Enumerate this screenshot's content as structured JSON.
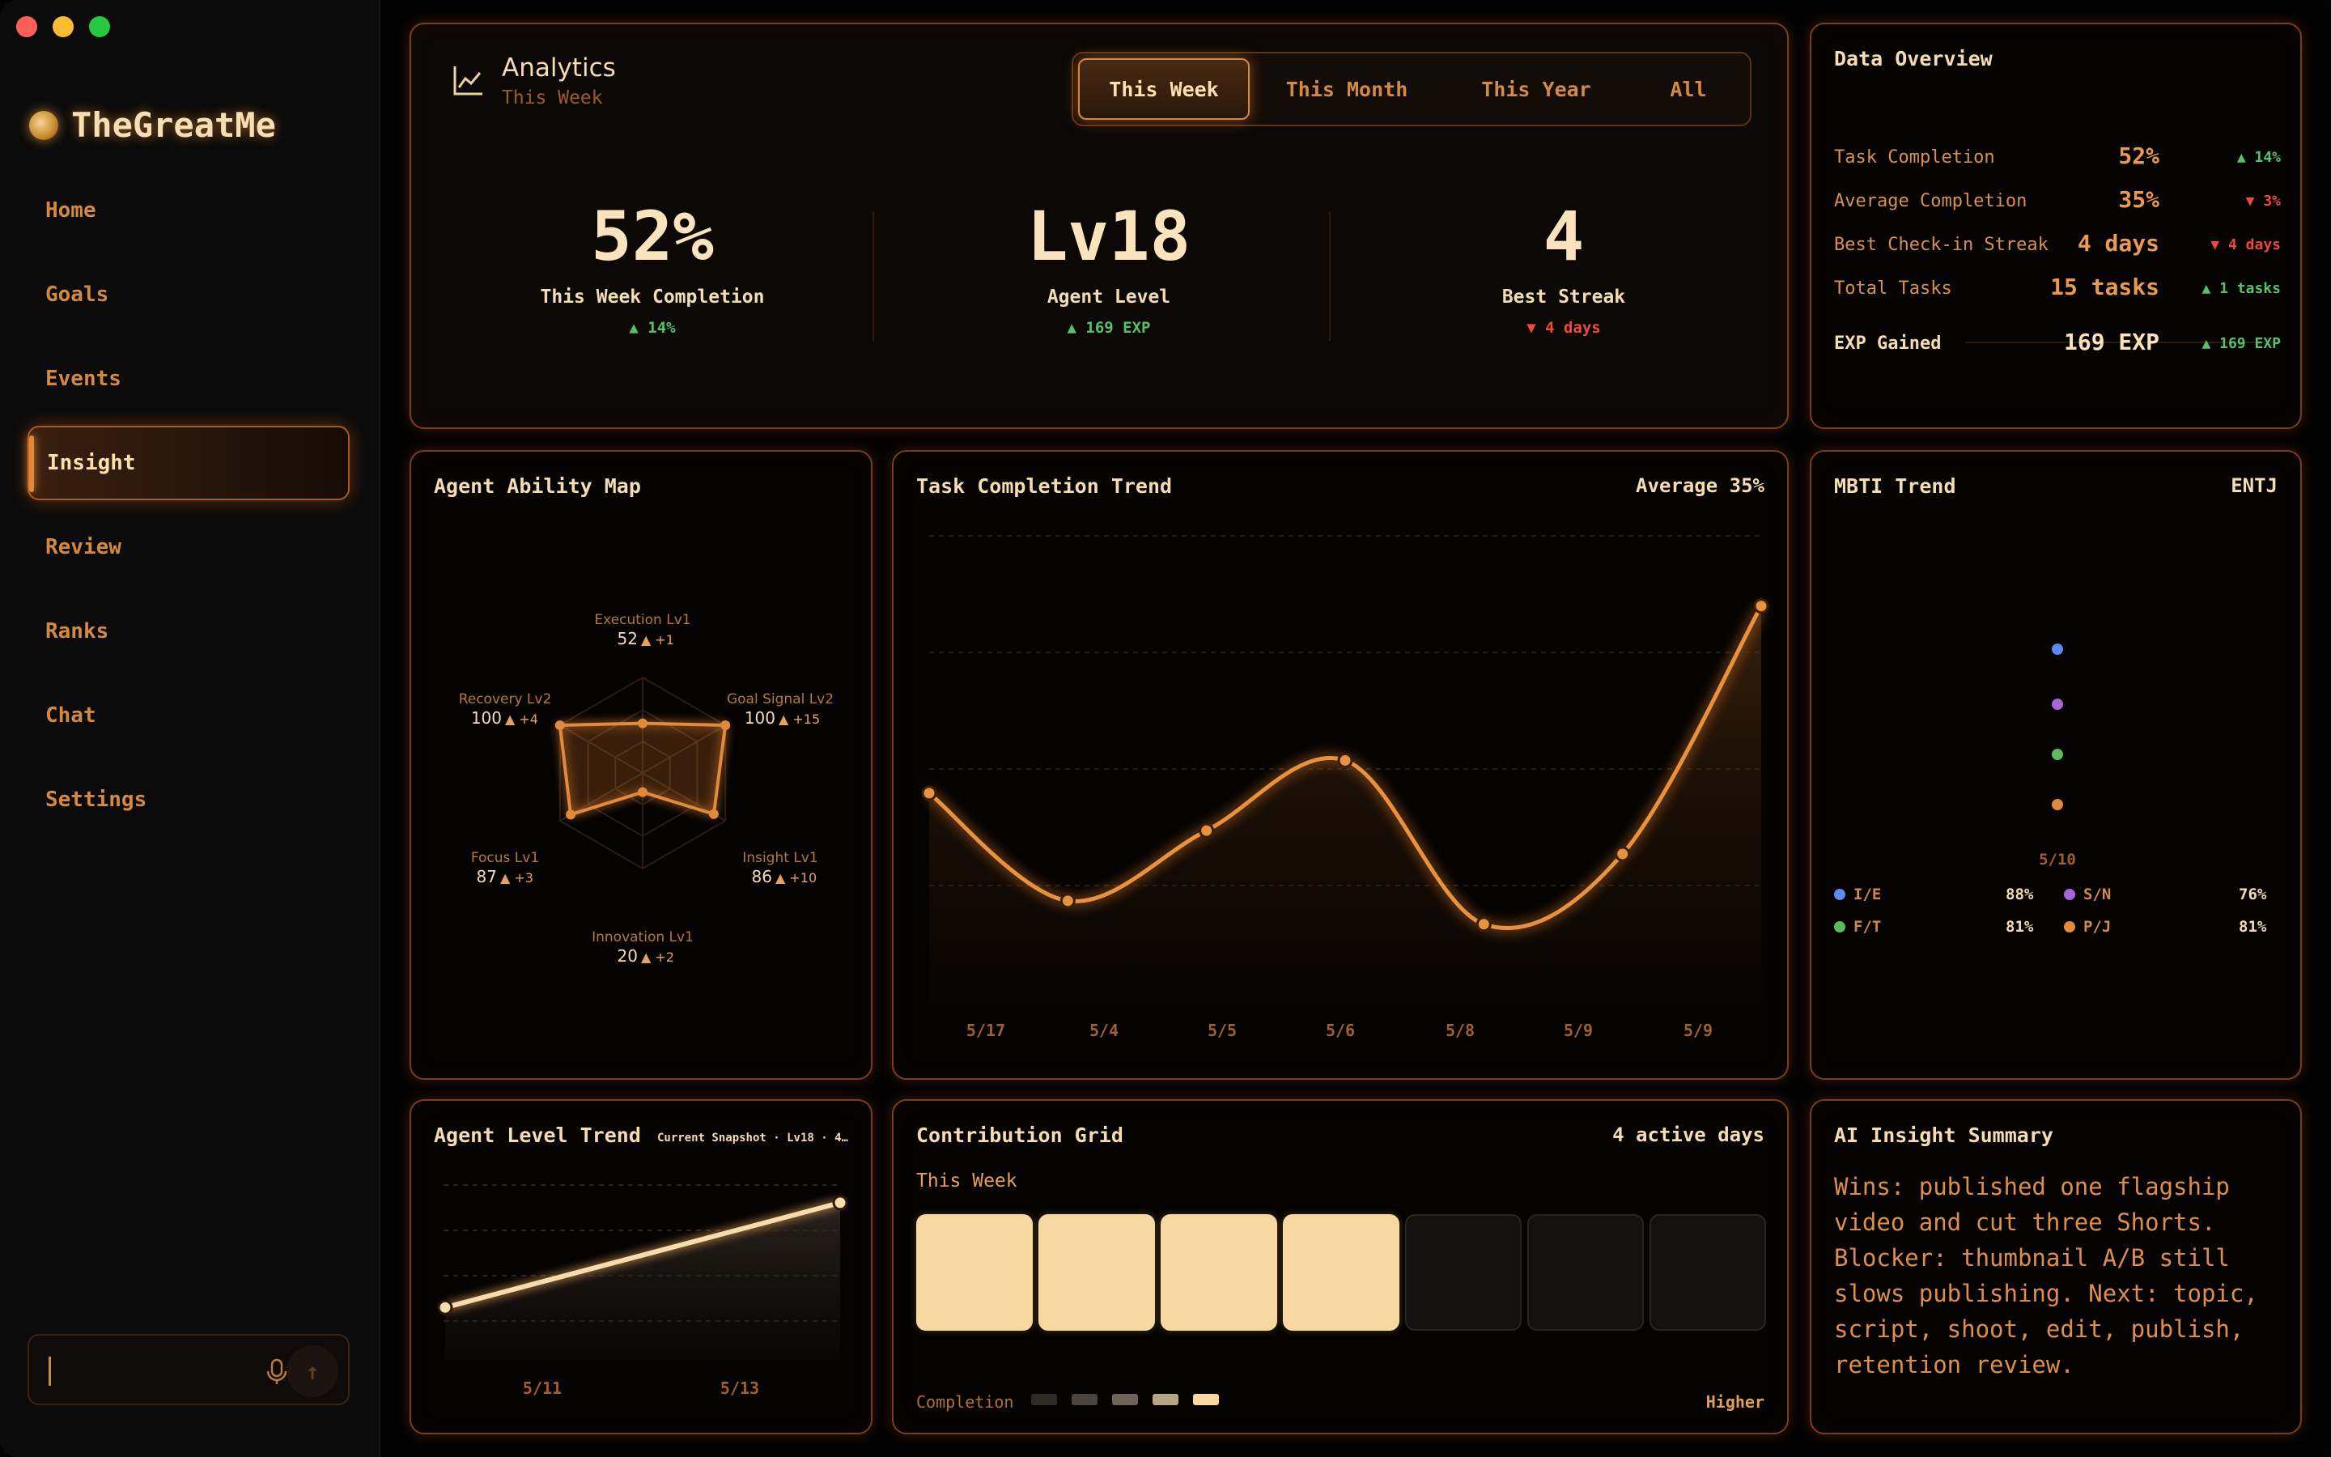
{
  "brand": {
    "name": "TheGreatMe"
  },
  "nav": {
    "items": [
      {
        "label": "Home"
      },
      {
        "label": "Goals"
      },
      {
        "label": "Events"
      },
      {
        "label": "Insight"
      },
      {
        "label": "Review"
      },
      {
        "label": "Ranks"
      },
      {
        "label": "Chat"
      },
      {
        "label": "Settings"
      }
    ],
    "active": "Insight"
  },
  "chat": {
    "value": "",
    "placeholder": ""
  },
  "analytics": {
    "title": "Analytics",
    "subtitle": "This Week",
    "tabs": [
      {
        "label": "This Week"
      },
      {
        "label": "This Month"
      },
      {
        "label": "This Year"
      },
      {
        "label": "All"
      }
    ],
    "active_tab": "This Week",
    "stats": [
      {
        "value": "52%",
        "label": "This Week Completion",
        "change": "▲ 14%",
        "trend": "up"
      },
      {
        "value": "Lv18",
        "label": "Agent Level",
        "change": "▲ 169 EXP",
        "trend": "up"
      },
      {
        "value": "4",
        "label": "Best Streak",
        "change": "▼ 4 days",
        "trend": "down"
      }
    ]
  },
  "overview": {
    "title": "Data Overview",
    "rows": [
      {
        "label": "Task Completion",
        "value": "52%",
        "change": "▲ 14%",
        "trend": "up"
      },
      {
        "label": "Average Completion",
        "value": "35%",
        "change": "▼ 3%",
        "trend": "down"
      },
      {
        "label": "Best Check-in Streak",
        "value": "4 days",
        "change": "▼ 4 days",
        "trend": "down"
      },
      {
        "label": "Total Tasks",
        "value": "15 tasks",
        "change": "▲ 1 tasks",
        "trend": "up"
      },
      {
        "label": "EXP Gained",
        "value": "169 EXP",
        "change": "▲ 169 EXP",
        "trend": "up"
      }
    ]
  },
  "radar": {
    "title": "Agent Ability Map",
    "axes": [
      {
        "name": "Execution Lv1",
        "value": 52,
        "change": "▲ +1"
      },
      {
        "name": "Goal Signal Lv2",
        "value": 100,
        "change": "▲ +15"
      },
      {
        "name": "Insight Lv1",
        "value": 86,
        "change": "▲ +10"
      },
      {
        "name": "Innovation Lv1",
        "value": 20,
        "change": "▲ +2"
      },
      {
        "name": "Focus Lv1",
        "value": 87,
        "change": "▲ +3"
      },
      {
        "name": "Recovery Lv2",
        "value": 100,
        "change": "▲ +4"
      }
    ]
  },
  "trend": {
    "title": "Task Completion Trend",
    "average_label": "Average 35%"
  },
  "mbti": {
    "title": "MBTI Trend",
    "type": "ENTJ",
    "date": "5/10",
    "dims": [
      {
        "label": "I/E",
        "value": "88%",
        "color": "#5b8bf0"
      },
      {
        "label": "S/N",
        "value": "76%",
        "color": "#a865d8"
      },
      {
        "label": "F/T",
        "value": "81%",
        "color": "#5dbb5a"
      },
      {
        "label": "P/J",
        "value": "81%",
        "color": "#e28a3a"
      }
    ]
  },
  "level": {
    "title": "Agent Level Trend",
    "meta": "Current Snapshot · Lv18 · 4…"
  },
  "grid": {
    "title": "Contribution Grid",
    "active_days": "4 active days",
    "subtitle": "This Week",
    "days": [
      1,
      1,
      1,
      1,
      0,
      0,
      0
    ],
    "completion_label": "Completion",
    "higher_label": "Higher",
    "legend_colors": [
      "#2e2a26",
      "#4a4540",
      "#6e6355",
      "#b8a384",
      "#f6d8a0"
    ]
  },
  "ai": {
    "title": "AI Insight Summary",
    "text": "Wins: published one flagship video and cut three Shorts. Blocker: thumbnail A/B still slows publishing. Next: topic, script, shoot, edit, publish, retention review."
  },
  "colors": {
    "accent": "#e08a3c",
    "panel_border": "#7a3e16",
    "text_light": "#f5dcb2",
    "up": "#58c06a",
    "down": "#ee4a3a"
  },
  "chart_data": [
    {
      "type": "line",
      "title": "Task Completion Trend",
      "x": [
        "5/17",
        "5/4",
        "5/5",
        "5/6",
        "5/8",
        "5/9",
        "5/9"
      ],
      "series": [
        {
          "values": [
            45,
            22,
            37,
            52,
            17,
            32,
            85
          ]
        }
      ],
      "ylim": [
        0,
        100
      ],
      "grid": true
    },
    {
      "type": "line",
      "title": "Agent Level Trend",
      "x": [
        "5/11",
        "5/13"
      ],
      "series": [
        {
          "values": [
            17,
            18
          ]
        }
      ],
      "ylim": [
        16.5,
        18.2
      ],
      "grid": true
    }
  ]
}
